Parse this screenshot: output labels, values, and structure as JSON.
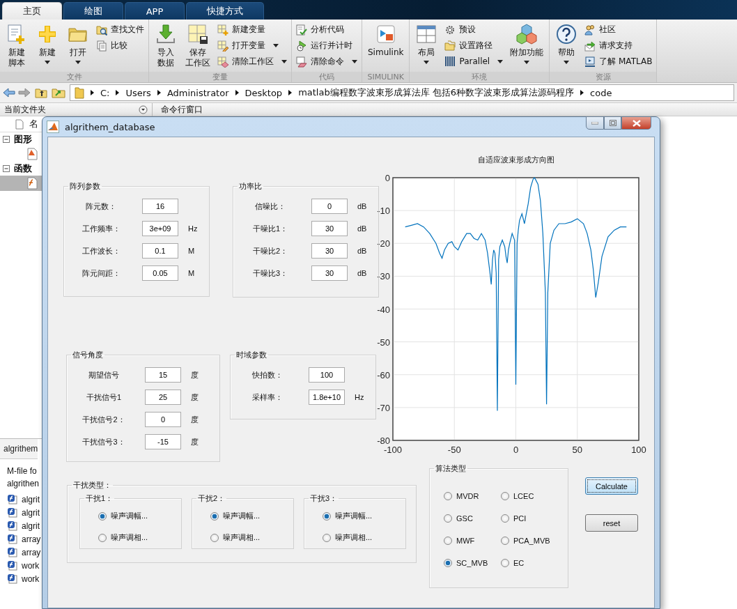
{
  "tabs": [
    {
      "label": "主页",
      "selected": true
    },
    {
      "label": "绘图",
      "selected": false
    },
    {
      "label": "APP",
      "selected": false
    },
    {
      "label": "快捷方式",
      "selected": false
    }
  ],
  "ribbon": {
    "groups": [
      {
        "label": "文件",
        "items": [
          {
            "kind": "large",
            "lines": [
              "新建",
              "脚本"
            ],
            "dropdown": false
          },
          {
            "kind": "large",
            "lines": [
              "新建"
            ],
            "dropdown": true
          },
          {
            "kind": "large",
            "lines": [
              "打开"
            ],
            "dropdown": true
          },
          {
            "kind": "column",
            "items": [
              {
                "label": "查找文件",
                "dropdown": false
              },
              {
                "label": "比较",
                "dropdown": false
              }
            ]
          }
        ]
      },
      {
        "label": "变量",
        "items": [
          {
            "kind": "large",
            "lines": [
              "导入",
              "数据"
            ],
            "dropdown": false
          },
          {
            "kind": "large",
            "lines": [
              "保存",
              "工作区"
            ],
            "dropdown": false
          },
          {
            "kind": "column",
            "items": [
              {
                "label": "新建变量",
                "dropdown": false
              },
              {
                "label": "打开变量",
                "dropdown": true
              },
              {
                "label": "清除工作区",
                "dropdown": true
              }
            ]
          }
        ]
      },
      {
        "label": "代码",
        "items": [
          {
            "kind": "column",
            "items": [
              {
                "label": "分析代码",
                "dropdown": false
              },
              {
                "label": "运行并计时",
                "dropdown": false
              },
              {
                "label": "清除命令",
                "dropdown": true
              }
            ]
          }
        ]
      },
      {
        "label": "SIMULINK",
        "items": [
          {
            "kind": "large",
            "lines": [
              "Simulink"
            ],
            "dropdown": false
          }
        ]
      },
      {
        "label": "环境",
        "items": [
          {
            "kind": "large",
            "lines": [
              "布局"
            ],
            "dropdown": true
          },
          {
            "kind": "column",
            "items": [
              {
                "label": "预设",
                "dropdown": false
              },
              {
                "label": "设置路径",
                "dropdown": false
              },
              {
                "label": "Parallel",
                "dropdown": true
              }
            ]
          },
          {
            "kind": "large",
            "lines": [
              "附加功能"
            ],
            "dropdown": true
          }
        ]
      },
      {
        "label": "资源",
        "items": [
          {
            "kind": "large",
            "lines": [
              "帮助"
            ],
            "dropdown": true
          },
          {
            "kind": "column",
            "items": [
              {
                "label": "社区",
                "dropdown": false
              },
              {
                "label": "请求支持",
                "dropdown": false
              },
              {
                "label": "了解 MATLAB",
                "dropdown": false
              }
            ]
          }
        ]
      }
    ]
  },
  "address": {
    "segments": [
      "C:",
      "Users",
      "Administrator",
      "Desktop",
      "matlab编程数字波束形成算法库 包括6种数字波束形成算法源码程序",
      "code"
    ]
  },
  "current_folder": {
    "title": "当前文件夹",
    "column": "名",
    "tree": [
      {
        "label": "图形",
        "expanded": true,
        "children": [
          {
            "selected": false
          }
        ]
      },
      {
        "label": "函数",
        "expanded": true,
        "children": [
          {
            "selected": true
          }
        ]
      }
    ],
    "details": {
      "title": "algrithem",
      "description": [
        "M-file fo",
        "algrithen"
      ],
      "files": [
        "algrit",
        "algrit",
        "algrit",
        "array",
        "array",
        "work",
        "work"
      ]
    }
  },
  "command_window": {
    "title": "命令行窗口"
  },
  "dialog": {
    "title": "algrithem_database",
    "panels": [
      {
        "kind": "fields",
        "title": "阵列参数",
        "fields": [
          {
            "label": "阵元数：",
            "value": "16"
          },
          {
            "label": "工作频率：",
            "value": "3e+09",
            "unit": "Hz"
          },
          {
            "label": "工作波长：",
            "value": "0.1",
            "unit": "M"
          },
          {
            "label": "阵元间距：",
            "value": "0.05",
            "unit": "M"
          }
        ]
      },
      {
        "kind": "fields",
        "title": "功率比",
        "fields": [
          {
            "label": "信噪比：",
            "value": "0",
            "unit": "dB"
          },
          {
            "label": "干噪比1：",
            "value": "30",
            "unit": "dB"
          },
          {
            "label": "干噪比2：",
            "value": "30",
            "unit": "dB"
          },
          {
            "label": "干噪比3：",
            "value": "30",
            "unit": "dB"
          }
        ]
      },
      {
        "kind": "fields",
        "title": "信号角度",
        "fields": [
          {
            "label": "期望信号",
            "value": "15",
            "unit": "度"
          },
          {
            "label": "干扰信号1",
            "value": "25",
            "unit": "度"
          },
          {
            "label": "干扰信号2：",
            "value": "0",
            "unit": "度"
          },
          {
            "label": "干扰信号3：",
            "value": "-15",
            "unit": "度"
          }
        ]
      },
      {
        "kind": "fields",
        "title": "时域参数",
        "fields": [
          {
            "label": "快拍数：",
            "value": "100"
          },
          {
            "label": "采样率：",
            "value": "1.8e+10",
            "unit": "Hz"
          }
        ]
      },
      {
        "kind": "radio_groups",
        "title": "干扰类型：",
        "groups": [
          {
            "title": "干扰1：",
            "options": [
              {
                "label": "噪声调幅...",
                "selected": true
              },
              {
                "label": "噪声调相...",
                "selected": false
              }
            ]
          },
          {
            "title": "干扰2：",
            "options": [
              {
                "label": "噪声调幅...",
                "selected": true
              },
              {
                "label": "噪声调相...",
                "selected": false
              }
            ]
          },
          {
            "title": "干扰3：",
            "options": [
              {
                "label": "噪声调幅...",
                "selected": true
              },
              {
                "label": "噪声调相...",
                "selected": false
              }
            ]
          }
        ]
      },
      {
        "kind": "radio_grid",
        "title": "算法类型",
        "options": [
          {
            "label": "MVDR",
            "selected": false
          },
          {
            "label": "LCEC",
            "selected": false
          },
          {
            "label": "GSC",
            "selected": false
          },
          {
            "label": "PCI",
            "selected": false
          },
          {
            "label": "MWF",
            "selected": false
          },
          {
            "label": "PCA_MVB",
            "selected": false
          },
          {
            "label": "SC_MVB",
            "selected": true
          },
          {
            "label": "EC",
            "selected": false
          }
        ]
      }
    ],
    "buttons": [
      {
        "label": "Calculate",
        "default": true
      },
      {
        "label": "reset",
        "default": false
      }
    ],
    "chart_data": {
      "type": "line",
      "title": "自适应波束形成方向图",
      "x": [
        -90,
        -85,
        -80,
        -75,
        -70,
        -65,
        -62,
        -60,
        -58,
        -55,
        -52,
        -50,
        -47,
        -44,
        -40,
        -37,
        -34,
        -31,
        -28,
        -25,
        -23,
        -21,
        -20,
        -19,
        -18,
        -17,
        -16,
        -15,
        -14,
        -13,
        -11,
        -9,
        -8,
        -7,
        -6,
        -5,
        -3,
        -1,
        0,
        1,
        2,
        3,
        5,
        7,
        8,
        10,
        12,
        14,
        15,
        16,
        18,
        20,
        22,
        24,
        25,
        26,
        28,
        31,
        35,
        40,
        45,
        50,
        55,
        58,
        61,
        63,
        65,
        67,
        70,
        75,
        80,
        85,
        90
      ],
      "series": [
        {
          "color": "#0072bd",
          "values": [
            -15,
            -14.5,
            -14,
            -15,
            -17,
            -20,
            -23,
            -24.5,
            -22,
            -20,
            -19.5,
            -21,
            -22,
            -19.5,
            -17,
            -17,
            -18.5,
            -19,
            -17,
            -19,
            -23,
            -29,
            -32.5,
            -25,
            -22,
            -23,
            -29,
            -71,
            -25,
            -21,
            -19,
            -21,
            -24,
            -26,
            -22,
            -20,
            -17,
            -19,
            -63,
            -20,
            -16,
            -13,
            -11,
            -14,
            -12,
            -8,
            -3,
            -0.5,
            0,
            -0.5,
            -2,
            -7,
            -17,
            -35,
            -69,
            -35,
            -20,
            -16,
            -14,
            -14,
            -13.5,
            -12.5,
            -14,
            -17,
            -22,
            -28,
            -36.5,
            -32,
            -24,
            -18,
            -16,
            -15,
            -15
          ]
        }
      ],
      "xlim": [
        -100,
        100
      ],
      "ylim": [
        -80,
        0
      ],
      "xticks": [
        -100,
        -50,
        0,
        50,
        100
      ],
      "yticks": [
        -80,
        -70,
        -60,
        -50,
        -40,
        -30,
        -20,
        -10,
        0
      ],
      "grid": true
    }
  }
}
